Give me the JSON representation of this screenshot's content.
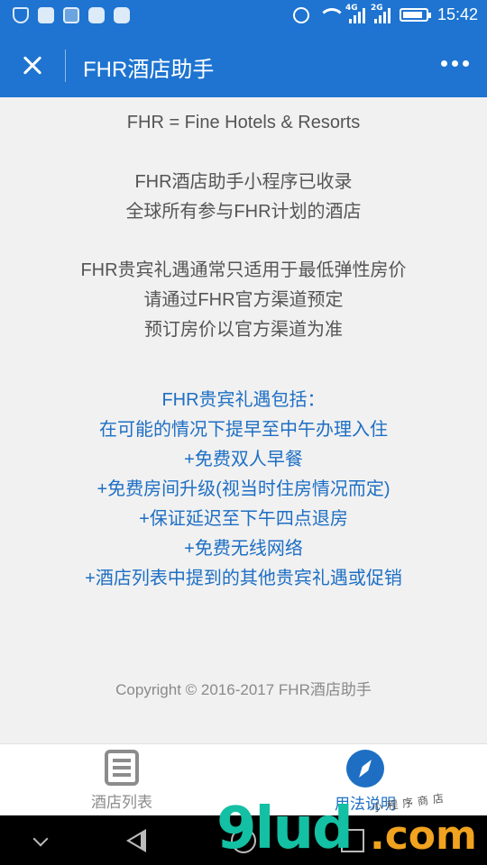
{
  "status_bar": {
    "time": "15:42",
    "net1": "4G",
    "net2": "2G"
  },
  "header": {
    "title": "FHR酒店助手"
  },
  "content": {
    "tagline": "FHR = Fine Hotels & Resorts",
    "intro": [
      "FHR酒店助手小程序已收录",
      "全球所有参与FHR计划的酒店"
    ],
    "notes": [
      "FHR贵宾礼遇通常只适用于最低弹性房价",
      "请通过FHR官方渠道预定",
      "预订房价以官方渠道为准"
    ],
    "benefits": [
      "FHR贵宾礼遇包括：",
      "在可能的情况下提早至中午办理入住",
      "+免费双人早餐",
      "+免费房间升级(视当时住房情况而定)",
      "+保证延迟至下午四点退房",
      "+免费无线网络",
      "+酒店列表中提到的其他贵宾礼遇或促销"
    ],
    "copyright": "Copyright © 2016-2017 FHR酒店助手"
  },
  "tabs": [
    {
      "label": "酒店列表",
      "icon": "list-icon",
      "active": false
    },
    {
      "label": "用法说明",
      "icon": "compass-icon",
      "active": true
    }
  ],
  "watermark": {
    "main": "9lud",
    "suffix": ".com",
    "small": "小程序商店"
  },
  "colors": {
    "primary": "#1e74d0",
    "accent_text": "#1e6fc4",
    "body_text": "#555555",
    "background": "#f1f1f1"
  }
}
